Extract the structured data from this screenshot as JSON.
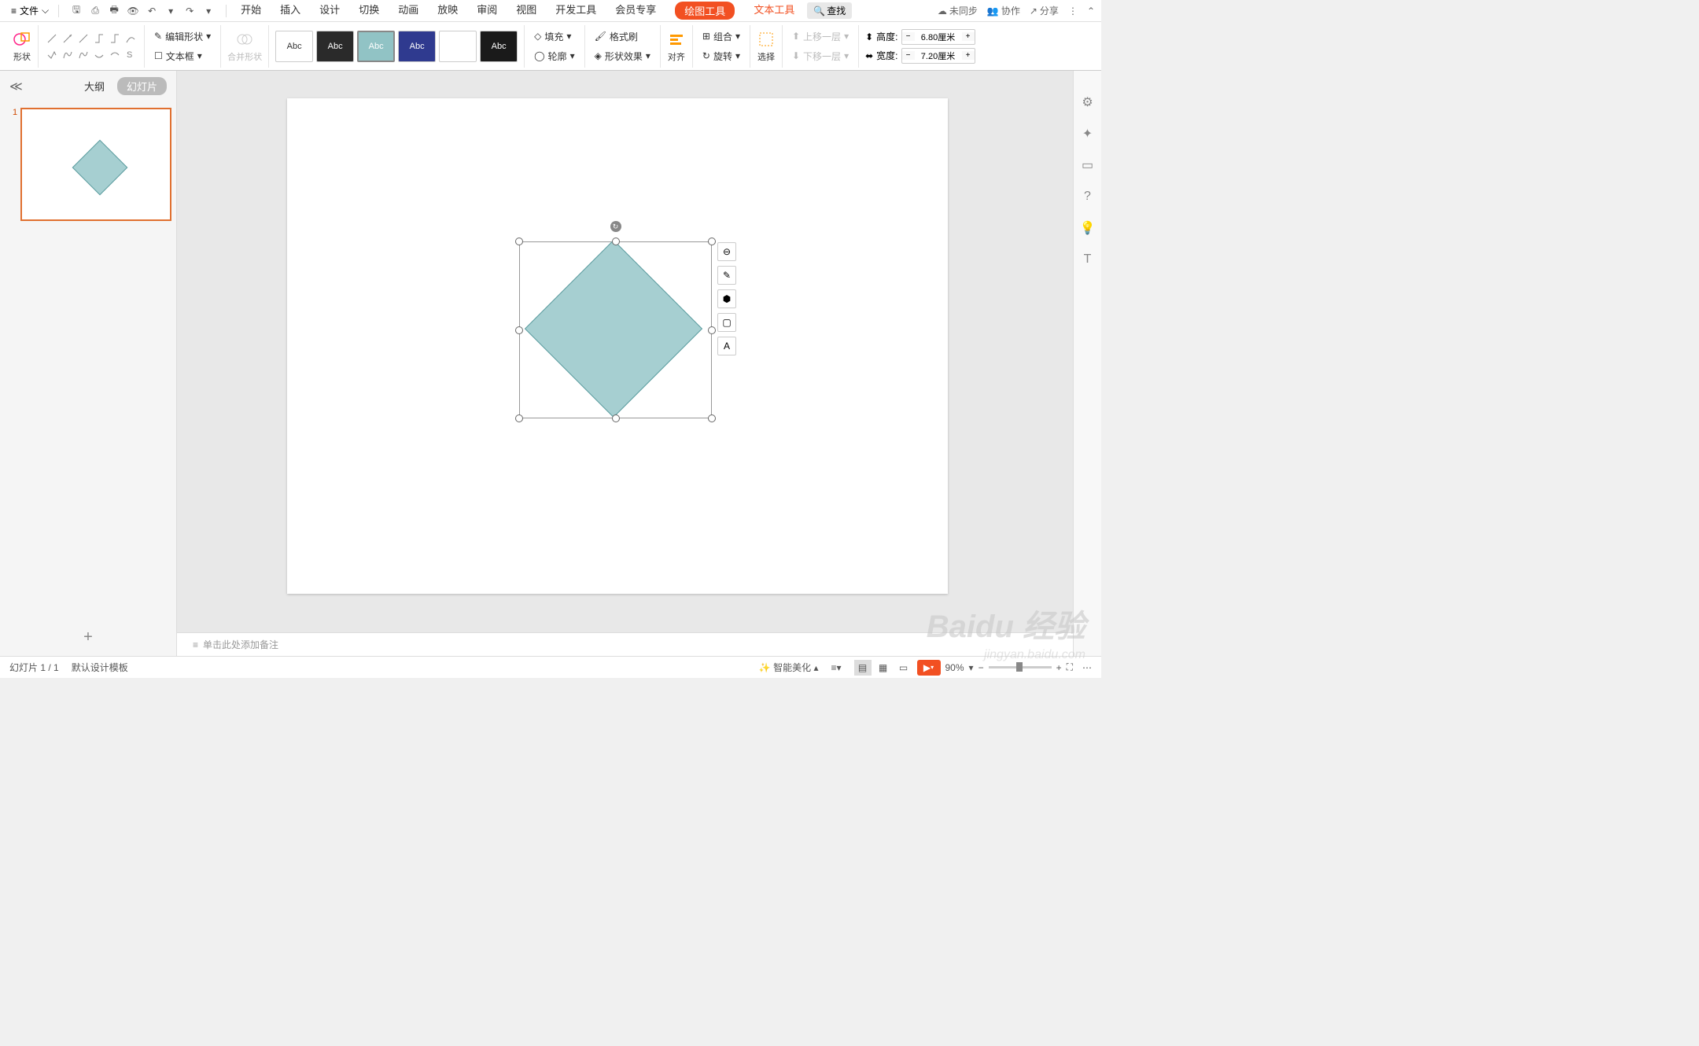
{
  "topbar": {
    "file": "文件",
    "tabs": [
      "开始",
      "插入",
      "设计",
      "切换",
      "动画",
      "放映",
      "审阅",
      "视图",
      "开发工具",
      "会员专享"
    ],
    "drawTool": "绘图工具",
    "textTool": "文本工具",
    "search": "查找",
    "unsync": "未同步",
    "collab": "协作",
    "share": "分享"
  },
  "ribbon": {
    "shape": "形状",
    "editShape": "编辑形状",
    "textBox": "文本框",
    "mergeShape": "合并形状",
    "styleText": "Abc",
    "fill": "填充",
    "formatBrush": "格式刷",
    "outline": "轮廓",
    "shapeEffect": "形状效果",
    "align": "对齐",
    "group": "组合",
    "rotate": "旋转",
    "select": "选择",
    "moveUp": "上移一层",
    "moveDown": "下移一层",
    "height": "高度:",
    "width": "宽度:",
    "heightVal": "6.80厘米",
    "widthVal": "7.20厘米"
  },
  "sidebar": {
    "outline": "大纲",
    "slides": "幻灯片",
    "slideNum": "1"
  },
  "notes": "单击此处添加备注",
  "status": {
    "slideCount": "幻灯片 1 / 1",
    "template": "默认设计模板",
    "beautify": "智能美化",
    "zoom": "90%"
  },
  "watermark": {
    "main": "Baidu 经验",
    "sub": "jingyan.baidu.com"
  }
}
